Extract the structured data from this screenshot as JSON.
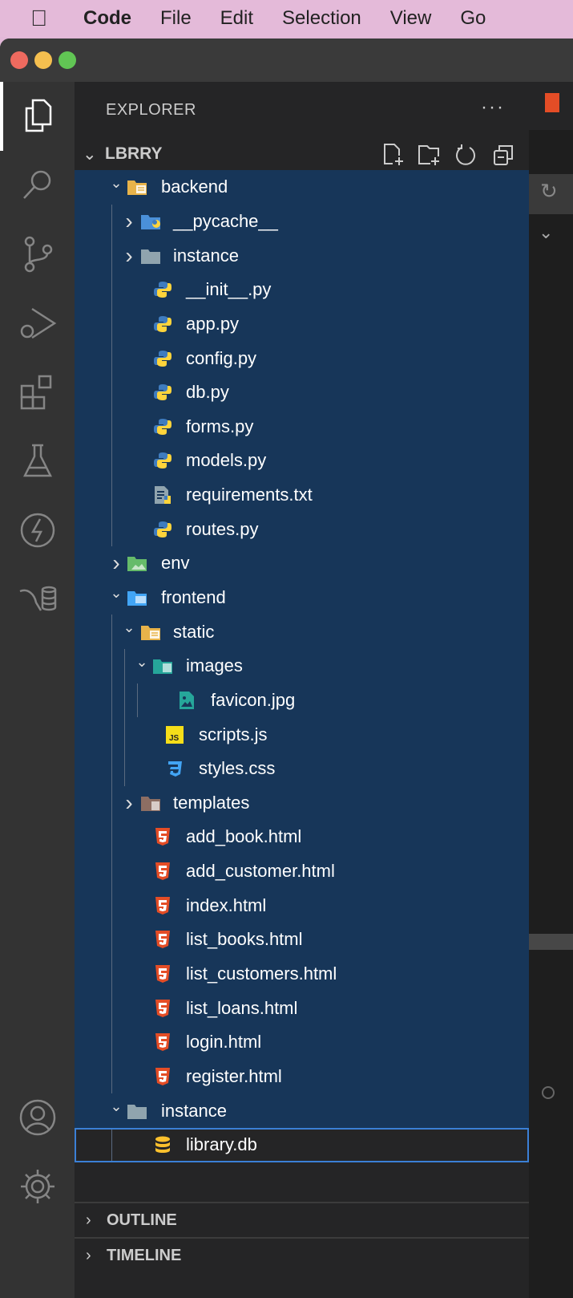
{
  "menubar": {
    "app": "Code",
    "items": [
      "File",
      "Edit",
      "Selection",
      "View",
      "Go"
    ]
  },
  "sidebar": {
    "title": "EXPLORER",
    "more": "···",
    "root": "LBRRY"
  },
  "tree": [
    {
      "label": "backend",
      "depth": 0,
      "kind": "folder",
      "expanded": true,
      "icon": "folder-backend-icon",
      "color": "#e8b34a"
    },
    {
      "label": "__pycache__",
      "depth": 1,
      "kind": "folder",
      "expanded": false,
      "icon": "folder-python-icon",
      "color": "#4a90d9"
    },
    {
      "label": "instance",
      "depth": 1,
      "kind": "folder",
      "expanded": false,
      "icon": "folder-icon",
      "color": "#90a4ae"
    },
    {
      "label": "__init__.py",
      "depth": 1,
      "kind": "file",
      "icon": "python-icon"
    },
    {
      "label": "app.py",
      "depth": 1,
      "kind": "file",
      "icon": "python-icon"
    },
    {
      "label": "config.py",
      "depth": 1,
      "kind": "file",
      "icon": "python-icon"
    },
    {
      "label": "db.py",
      "depth": 1,
      "kind": "file",
      "icon": "python-icon"
    },
    {
      "label": "forms.py",
      "depth": 1,
      "kind": "file",
      "icon": "python-icon"
    },
    {
      "label": "models.py",
      "depth": 1,
      "kind": "file",
      "icon": "python-icon"
    },
    {
      "label": "requirements.txt",
      "depth": 1,
      "kind": "file",
      "icon": "requirements-icon"
    },
    {
      "label": "routes.py",
      "depth": 1,
      "kind": "file",
      "icon": "python-icon"
    },
    {
      "label": "env",
      "depth": 0,
      "kind": "folder",
      "expanded": false,
      "icon": "folder-env-icon",
      "color": "#66bb6a"
    },
    {
      "label": "frontend",
      "depth": 0,
      "kind": "folder",
      "expanded": true,
      "icon": "folder-frontend-icon",
      "color": "#42a5f5"
    },
    {
      "label": "static",
      "depth": 1,
      "kind": "folder",
      "expanded": true,
      "icon": "folder-static-icon",
      "color": "#e8b34a"
    },
    {
      "label": "images",
      "depth": 2,
      "kind": "folder",
      "expanded": true,
      "icon": "folder-images-icon",
      "color": "#26a69a"
    },
    {
      "label": "favicon.jpg",
      "depth": 3,
      "kind": "file",
      "icon": "image-icon"
    },
    {
      "label": "scripts.js",
      "depth": 2,
      "kind": "file",
      "icon": "javascript-icon"
    },
    {
      "label": "styles.css",
      "depth": 2,
      "kind": "file",
      "icon": "css-icon"
    },
    {
      "label": "templates",
      "depth": 1,
      "kind": "folder",
      "expanded": false,
      "icon": "folder-templates-icon",
      "color": "#8d6e63"
    },
    {
      "label": "add_book.html",
      "depth": 1,
      "kind": "file",
      "icon": "html-icon"
    },
    {
      "label": "add_customer.html",
      "depth": 1,
      "kind": "file",
      "icon": "html-icon"
    },
    {
      "label": "index.html",
      "depth": 1,
      "kind": "file",
      "icon": "html-icon"
    },
    {
      "label": "list_books.html",
      "depth": 1,
      "kind": "file",
      "icon": "html-icon"
    },
    {
      "label": "list_customers.html",
      "depth": 1,
      "kind": "file",
      "icon": "html-icon"
    },
    {
      "label": "list_loans.html",
      "depth": 1,
      "kind": "file",
      "icon": "html-icon"
    },
    {
      "label": "login.html",
      "depth": 1,
      "kind": "file",
      "icon": "html-icon"
    },
    {
      "label": "register.html",
      "depth": 1,
      "kind": "file",
      "icon": "html-icon"
    },
    {
      "label": "instance",
      "depth": 0,
      "kind": "folder",
      "expanded": true,
      "icon": "folder-open-icon",
      "color": "#90a4ae"
    },
    {
      "label": "library.db",
      "depth": 1,
      "kind": "file",
      "icon": "database-icon",
      "focused": true
    }
  ],
  "panels": [
    "OUTLINE",
    "TIMELINE"
  ],
  "colors": {
    "selection": "#173659",
    "focus": "#3b80d6",
    "html": "#e44d26",
    "python_blue": "#3572a5",
    "python_yellow": "#ffd43b"
  }
}
